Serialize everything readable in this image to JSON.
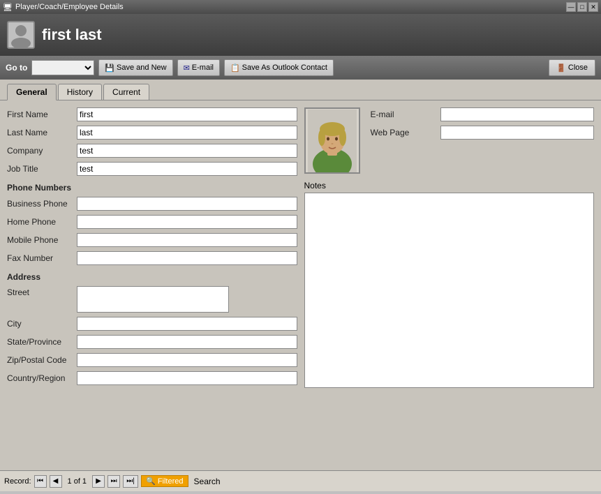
{
  "window": {
    "title": "Player/Coach/Employee Details",
    "min_icon": "—",
    "max_icon": "□",
    "close_icon": "✕"
  },
  "header": {
    "title": "first last",
    "icon_label": "person-icon"
  },
  "toolbar": {
    "goto_label": "Go to",
    "goto_placeholder": "",
    "save_new_label": "Save and New",
    "email_label": "E-mail",
    "save_outlook_label": "Save As Outlook Contact",
    "close_label": "Close"
  },
  "tabs": [
    {
      "id": "general",
      "label": "General",
      "active": true
    },
    {
      "id": "history",
      "label": "History",
      "active": false
    },
    {
      "id": "current",
      "label": "Current",
      "active": false
    }
  ],
  "form": {
    "personal": {
      "first_name_label": "First Name",
      "first_name_value": "first",
      "last_name_label": "Last Name",
      "last_name_value": "last",
      "company_label": "Company",
      "company_value": "test",
      "job_title_label": "Job Title",
      "job_title_value": "test"
    },
    "contact": {
      "email_label": "E-mail",
      "email_value": "",
      "web_page_label": "Web Page",
      "web_page_value": ""
    },
    "phone_numbers": {
      "section_title": "Phone Numbers",
      "business_phone_label": "Business Phone",
      "business_phone_value": "",
      "home_phone_label": "Home Phone",
      "home_phone_value": "",
      "mobile_phone_label": "Mobile Phone",
      "mobile_phone_value": "",
      "fax_number_label": "Fax Number",
      "fax_number_value": ""
    },
    "address": {
      "section_title": "Address",
      "street_label": "Street",
      "street_value": "",
      "city_label": "City",
      "city_value": "",
      "state_label": "State/Province",
      "state_value": "",
      "zip_label": "Zip/Postal Code",
      "zip_value": "",
      "country_label": "Country/Region",
      "country_value": ""
    },
    "notes": {
      "label": "Notes",
      "value": ""
    }
  },
  "status_bar": {
    "record_prefix": "Record:",
    "first_label": "⏮",
    "prev_label": "◀",
    "record_count": "1 of 1",
    "next_label": "▶",
    "last_label": "⏭",
    "extra_label": "⏭|",
    "filtered_label": "Filtered",
    "search_label": "Search"
  }
}
